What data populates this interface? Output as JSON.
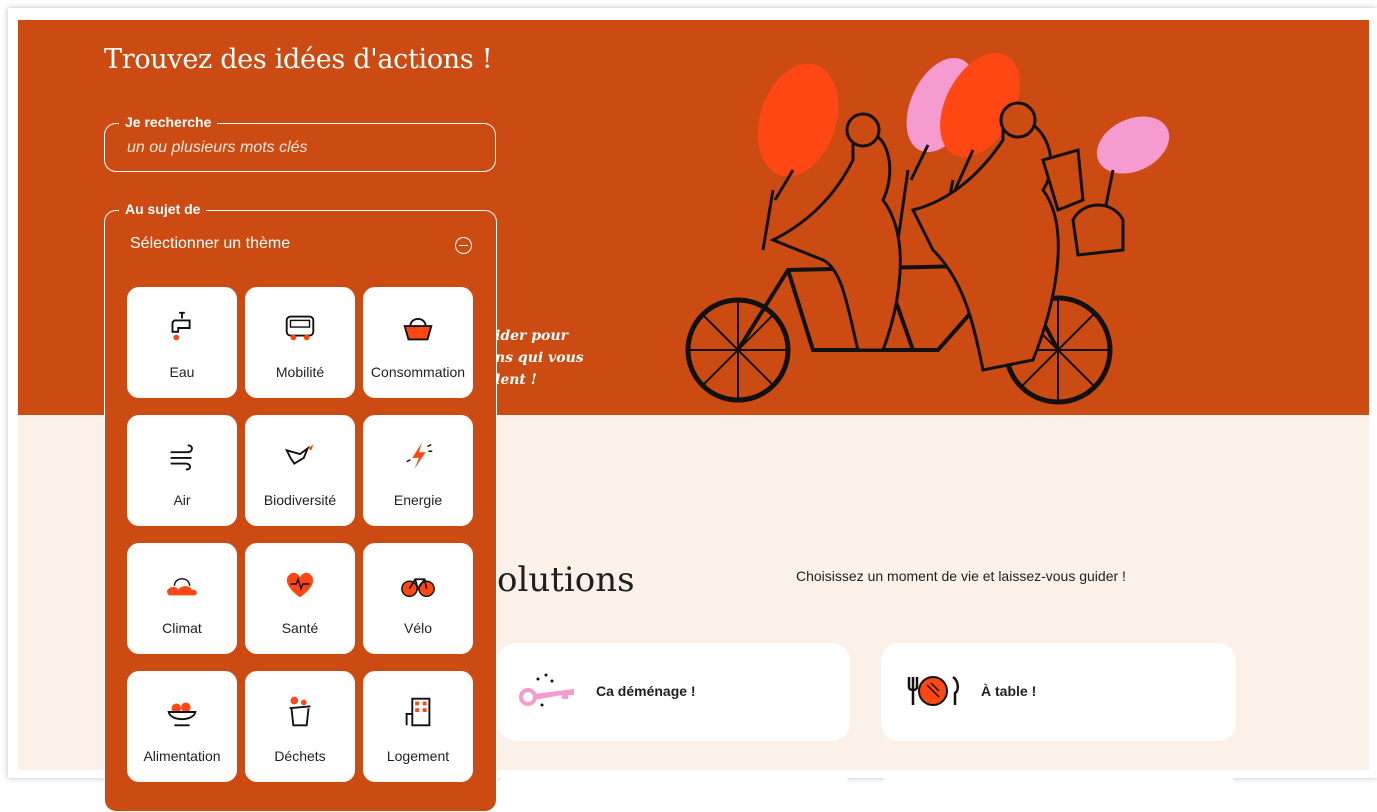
{
  "hero": {
    "title": "Trouvez des idées d'actions !",
    "cursive_lines": [
      "ider pour",
      "ns qui vous",
      "lent !"
    ]
  },
  "search": {
    "legend": "Je recherche",
    "placeholder": "un ou plusieurs mots clés",
    "value": ""
  },
  "theme_filter": {
    "legend": "Au sujet de",
    "select_label": "Sélectionner un thème",
    "collapse_icon": "minus-circle-icon",
    "themes": [
      {
        "label": "Eau",
        "icon": "water-tap-icon"
      },
      {
        "label": "Mobilité",
        "icon": "bus-icon"
      },
      {
        "label": "Consommation",
        "icon": "basket-icon"
      },
      {
        "label": "Air",
        "icon": "wind-icon"
      },
      {
        "label": "Biodiversité",
        "icon": "bird-icon"
      },
      {
        "label": "Energie",
        "icon": "lightning-icon"
      },
      {
        "label": "Climat",
        "icon": "sun-cloud-icon"
      },
      {
        "label": "Santé",
        "icon": "heart-pulse-icon"
      },
      {
        "label": "Vélo",
        "icon": "bicycle-icon"
      },
      {
        "label": "Alimentation",
        "icon": "food-bowl-icon"
      },
      {
        "label": "Déchets",
        "icon": "trash-bin-icon"
      },
      {
        "label": "Logement",
        "icon": "building-icon"
      }
    ]
  },
  "solutions": {
    "title_partial": "olutions",
    "subtitle": "Choisissez un moment de vie et laissez-vous guider !",
    "moments": [
      {
        "label": "Ca déménage !",
        "icon": "key-icon"
      },
      {
        "label": "À table !",
        "icon": "plate-cutlery-icon"
      }
    ]
  },
  "colors": {
    "brand_orange": "#cb4b13",
    "cream": "#fbf1e8",
    "accent_red": "#ff4713",
    "accent_pink": "#f59bd0"
  }
}
